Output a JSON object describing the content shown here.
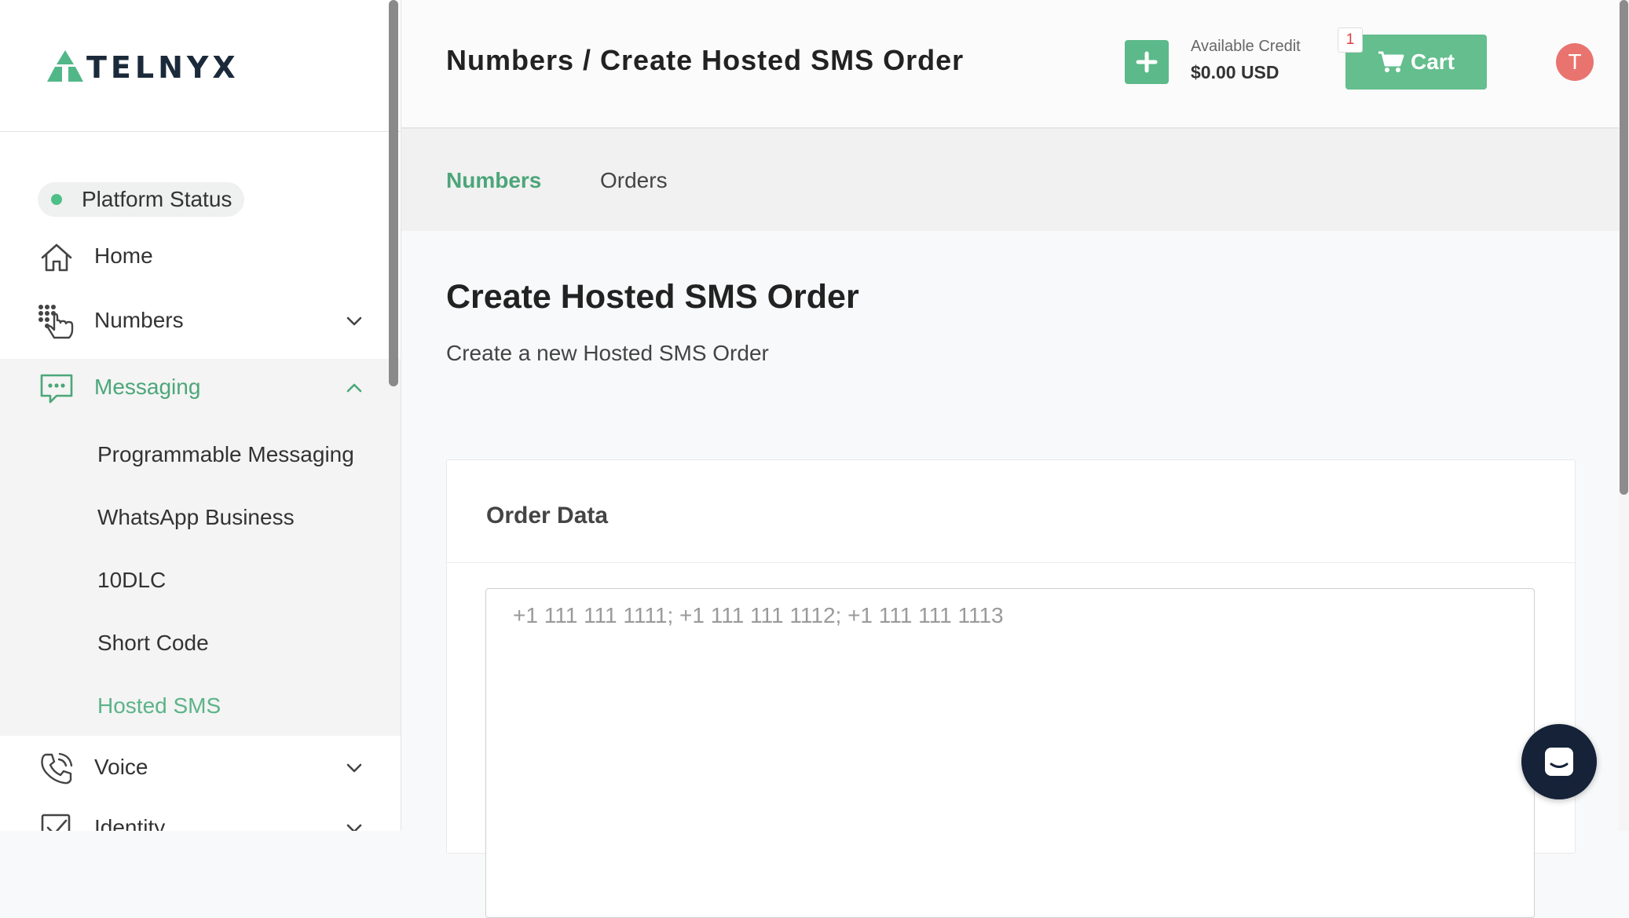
{
  "app": {
    "logo_text": "TELNYX",
    "accent_color": "#5cb98a"
  },
  "sidebar": {
    "platform_status": "Platform Status",
    "items": [
      {
        "label": "Home",
        "icon": "home-icon"
      },
      {
        "label": "Numbers",
        "icon": "dialpad-hand-icon"
      },
      {
        "label": "Messaging",
        "icon": "chat-bubble-icon"
      },
      {
        "label": "Voice",
        "icon": "phone-icon"
      },
      {
        "label": "Identity",
        "icon": "checkbox-icon"
      }
    ],
    "messaging_sub": [
      {
        "label": "Programmable Messaging"
      },
      {
        "label": "WhatsApp Business"
      },
      {
        "label": "10DLC"
      },
      {
        "label": "Short Code"
      },
      {
        "label": "Hosted SMS"
      }
    ]
  },
  "header": {
    "breadcrumb": "Numbers / Create Hosted SMS Order",
    "credit_label": "Available Credit",
    "credit_value": "$0.00 USD",
    "cart_label": "Cart",
    "cart_count": "1",
    "avatar_initial": "T"
  },
  "tabs": [
    {
      "label": "Numbers"
    },
    {
      "label": "Orders"
    }
  ],
  "main": {
    "title": "Create Hosted SMS Order",
    "subtitle": "Create a new Hosted SMS Order",
    "card_title": "Order Data",
    "textarea_placeholder": "+1 111 111 1111; +1 111 111 1112; +1 111 111 1113",
    "textarea_value": ""
  }
}
